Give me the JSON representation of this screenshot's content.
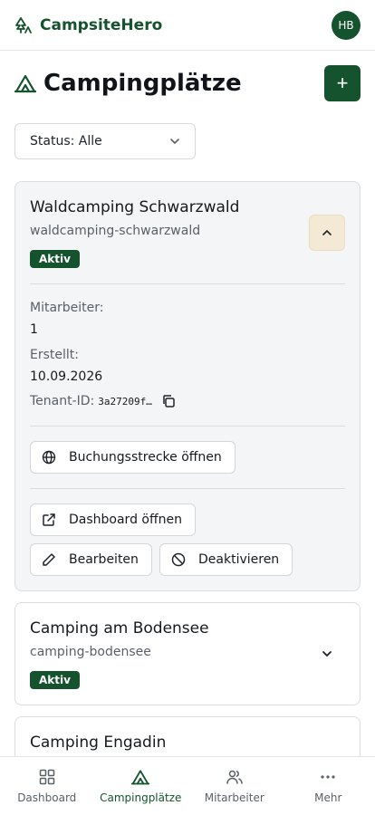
{
  "app": {
    "name": "CampsiteHero",
    "user_initials": "HB"
  },
  "page": {
    "title": "Campingplätze",
    "add_label": "+"
  },
  "filter": {
    "label": "Status: Alle"
  },
  "campsites": [
    {
      "name": "Waldcamping Schwarzwald",
      "slug": "waldcamping-schwarzwald",
      "status": "Aktiv",
      "details": {
        "staff_label": "Mitarbeiter:",
        "staff_value": "1",
        "created_label": "Erstellt:",
        "created_value": "10.09.2026",
        "tenant_label": "Tenant-ID:",
        "tenant_value": "3a27209f…"
      },
      "actions": {
        "booking": "Buchungsstrecke öffnen",
        "dashboard": "Dashboard öffnen",
        "edit": "Bearbeiten",
        "deactivate": "Deaktivieren"
      }
    },
    {
      "name": "Camping am Bodensee",
      "slug": "camping-bodensee",
      "status": "Aktiv"
    },
    {
      "name": "Camping Engadin"
    }
  ],
  "nav": [
    {
      "label": "Dashboard",
      "icon": "dashboard-icon"
    },
    {
      "label": "Campingplätze",
      "icon": "tent-icon",
      "active": true
    },
    {
      "label": "Mitarbeiter",
      "icon": "users-icon"
    },
    {
      "label": "Mehr",
      "icon": "more-icon"
    }
  ],
  "colors": {
    "primary": "#14532d",
    "accent_bg": "#f4e9d4"
  }
}
